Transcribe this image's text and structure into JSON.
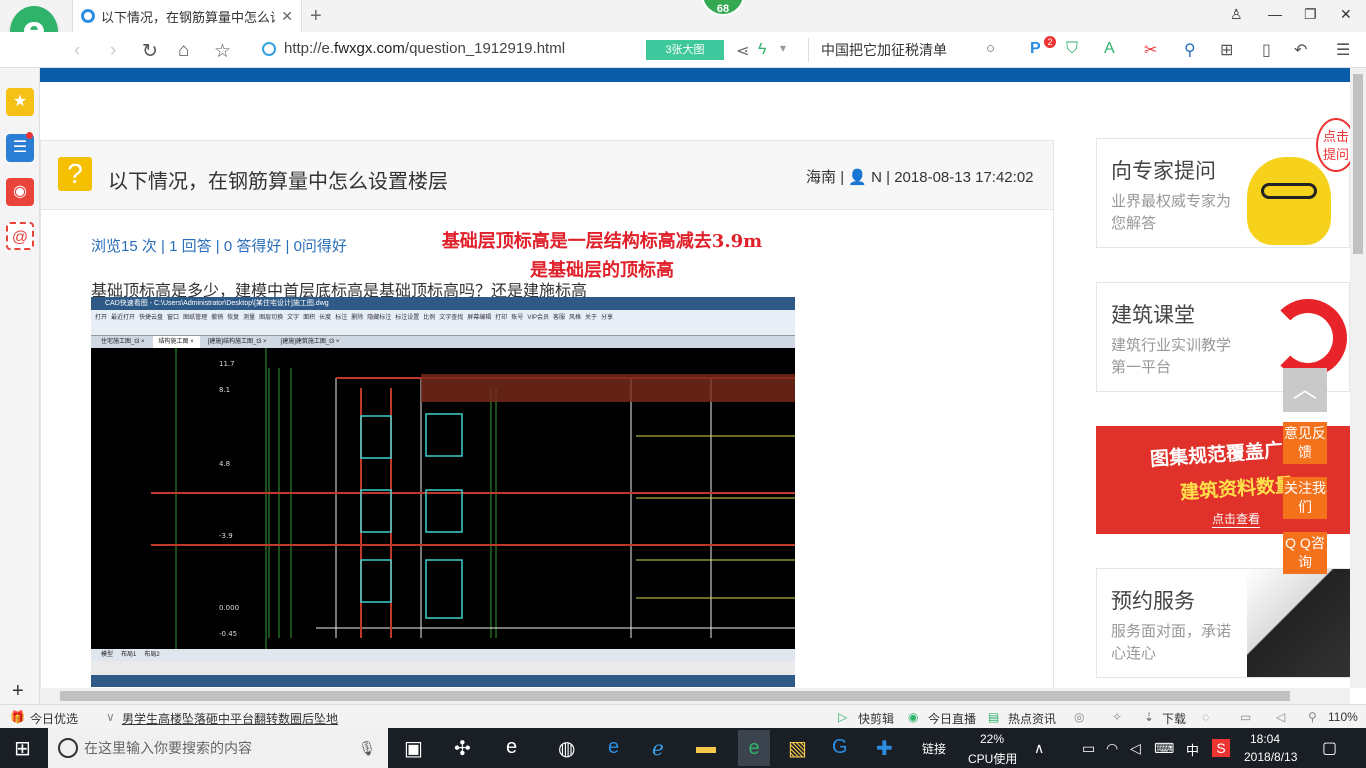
{
  "browser": {
    "logo_letter": "e",
    "tab_title": "以下情况，在钢筋算量中怎么设置",
    "badge_count": "68",
    "url_prefix": "http://e.",
    "url_domain": "fwxgx.com",
    "url_path": "/question_1912919.html",
    "big_image_btn": "3张大图",
    "search_text": "中国把它加征税清单",
    "toolbar_badge": "2"
  },
  "page": {
    "question": {
      "title": "以下情况，在钢筋算量中怎么设置楼层",
      "location": "海南",
      "user": "N",
      "datetime": "2018-08-13 17:42:02",
      "stats": "浏览15 次 | 1 回答 | 0 答得好 | 0问得好",
      "annotation_line1": "基础层顶标高是一层结构标高减去3.9m",
      "annotation_line2": "是基础层的顶标高",
      "body": "基础顶标高是多少，建模中首层底标高是基础顶标高吗？还是建施标高"
    },
    "cad_image": {
      "title": "CAD快速看图 - C:\\Users\\Administrator\\Desktop\\[某住宅设计]施工图.dwg",
      "ribbon": [
        "打开",
        "最近打开",
        "快捷云盘",
        "窗口",
        "图纸管理",
        "撤销",
        "恢复",
        "测量",
        "图层切换",
        "文字",
        "面积",
        "长度",
        "标注",
        "删除",
        "隐藏标注",
        "标注设置",
        "比例",
        "文字查找",
        "屏幕编辑",
        "打印",
        "账号",
        "VIP会员",
        "客服",
        "风格",
        "关于",
        "分享"
      ],
      "tabs": [
        "住宅施工图_t3",
        "结构施工图",
        "[建施]结构施工图_t3",
        "[建施]建筑施工图_t3"
      ],
      "elevations": [
        "11.7",
        "8.1",
        "4.8",
        "-3.9",
        "0.000",
        "-0.45"
      ],
      "footer_tabs": [
        "模型",
        "布局1",
        "布局2"
      ]
    },
    "sidebar": {
      "cards": [
        {
          "title": "向专家提问",
          "subtitle": "业界最权威专家为您解答"
        },
        {
          "title": "建筑课堂",
          "subtitle": "建筑行业实训教学第一平台"
        },
        {
          "title": "预约服务",
          "subtitle": "服务面对面，承诺心连心"
        }
      ],
      "bubble": "点击提问",
      "ad": {
        "line1": "图集规范覆盖广",
        "line2": "建筑资料数量",
        "line3": "点击查看"
      },
      "float_buttons": [
        "意见反馈",
        "关注我们",
        "Q Q咨询"
      ]
    }
  },
  "statusbar": {
    "today_pick": "今日优选",
    "headline": "男学生高楼坠落砸中平台翻转数圈后坠地",
    "items": [
      "快剪辑",
      "今日直播",
      "热点资讯",
      "下载"
    ],
    "zoom": "110%"
  },
  "taskbar": {
    "search_placeholder": "在这里输入你要搜索的内容",
    "network_label": "链接",
    "cpu_percent": "22%",
    "cpu_label": "CPU使用",
    "ime": "中",
    "time": "18:04",
    "date": "2018/8/13"
  },
  "colors": {
    "accent": "#0b5ca8",
    "red_annotation": "#e0202a",
    "float_orange": "#f4721c",
    "question_icon": "#f5c000"
  }
}
